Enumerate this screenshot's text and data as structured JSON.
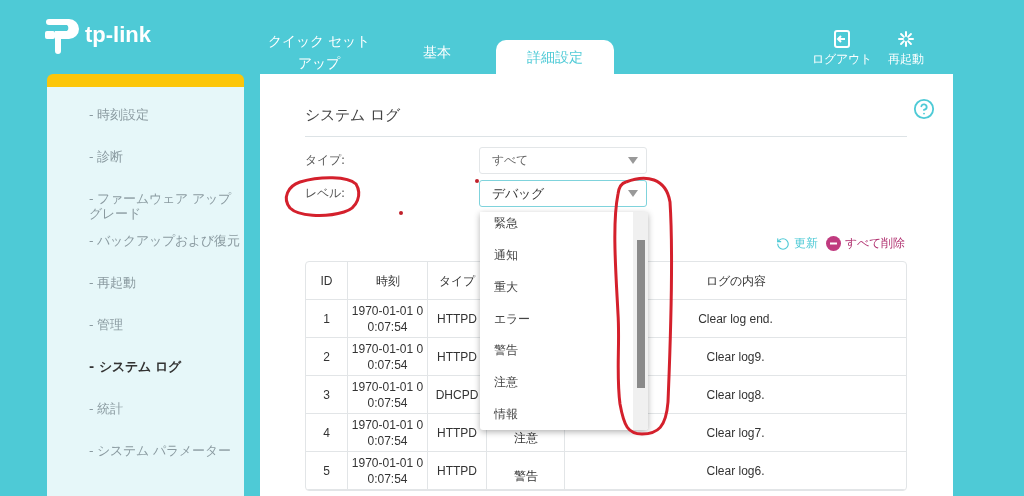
{
  "logo": "tp-link",
  "tabs": [
    {
      "label": "クイック セットアップ",
      "selected": false
    },
    {
      "label": "基本",
      "selected": false
    },
    {
      "label": "詳細設定",
      "selected": true
    }
  ],
  "header_actions": [
    {
      "kind": "logout",
      "label": "ログアウト"
    },
    {
      "kind": "reboot",
      "label": "再起動"
    }
  ],
  "sidebar": {
    "items": [
      {
        "label": "- 時刻設定",
        "selected": false
      },
      {
        "label": "- 診断",
        "selected": false
      },
      {
        "label": "- ファームウェア アップグレード",
        "selected": false
      },
      {
        "label": "- バックアップおよび復元",
        "selected": false
      },
      {
        "label": "- 再起動",
        "selected": false
      },
      {
        "label": "- 管理",
        "selected": false
      },
      {
        "label": "- システム ログ",
        "selected": true
      },
      {
        "label": "- 統計",
        "selected": false
      },
      {
        "label": "- システム パラメーター",
        "selected": false
      }
    ]
  },
  "page_title": "システム ログ",
  "filters": [
    {
      "label": "タイプ:",
      "value": "すべて",
      "focused": false
    },
    {
      "label": "レベル:",
      "value": "デバッグ",
      "focused": true
    }
  ],
  "level_dropdown": {
    "options": [
      "緊急",
      "通知",
      "重大",
      "エラー",
      "警告",
      "注意",
      "情報"
    ]
  },
  "actions": [
    {
      "kind": "refresh",
      "label": "更新"
    },
    {
      "kind": "delete",
      "label": "すべて削除"
    }
  ],
  "table": {
    "columns": [
      "ID",
      "時刻",
      "タイプ",
      null,
      "ログの内容"
    ],
    "rows": [
      {
        "id": "1",
        "time": "1970-01-01 0\n0:07:54",
        "type": "HTTPD",
        "content": "Clear log end."
      },
      {
        "id": "2",
        "time": "1970-01-01 0\n0:07:54",
        "type": "HTTPD",
        "content": "Clear log9."
      },
      {
        "id": "3",
        "time": "1970-01-01 0\n0:07:54",
        "type": "DHCPD",
        "content": "Clear log8."
      },
      {
        "id": "4",
        "time": "1970-01-01 0\n0:07:54",
        "type": "HTTPD",
        "level": "注意",
        "content": "Clear log7."
      },
      {
        "id": "5",
        "time": "1970-01-01 0\n0:07:54",
        "type": "HTTPD",
        "level": "警告",
        "content": "Clear log6."
      }
    ]
  }
}
